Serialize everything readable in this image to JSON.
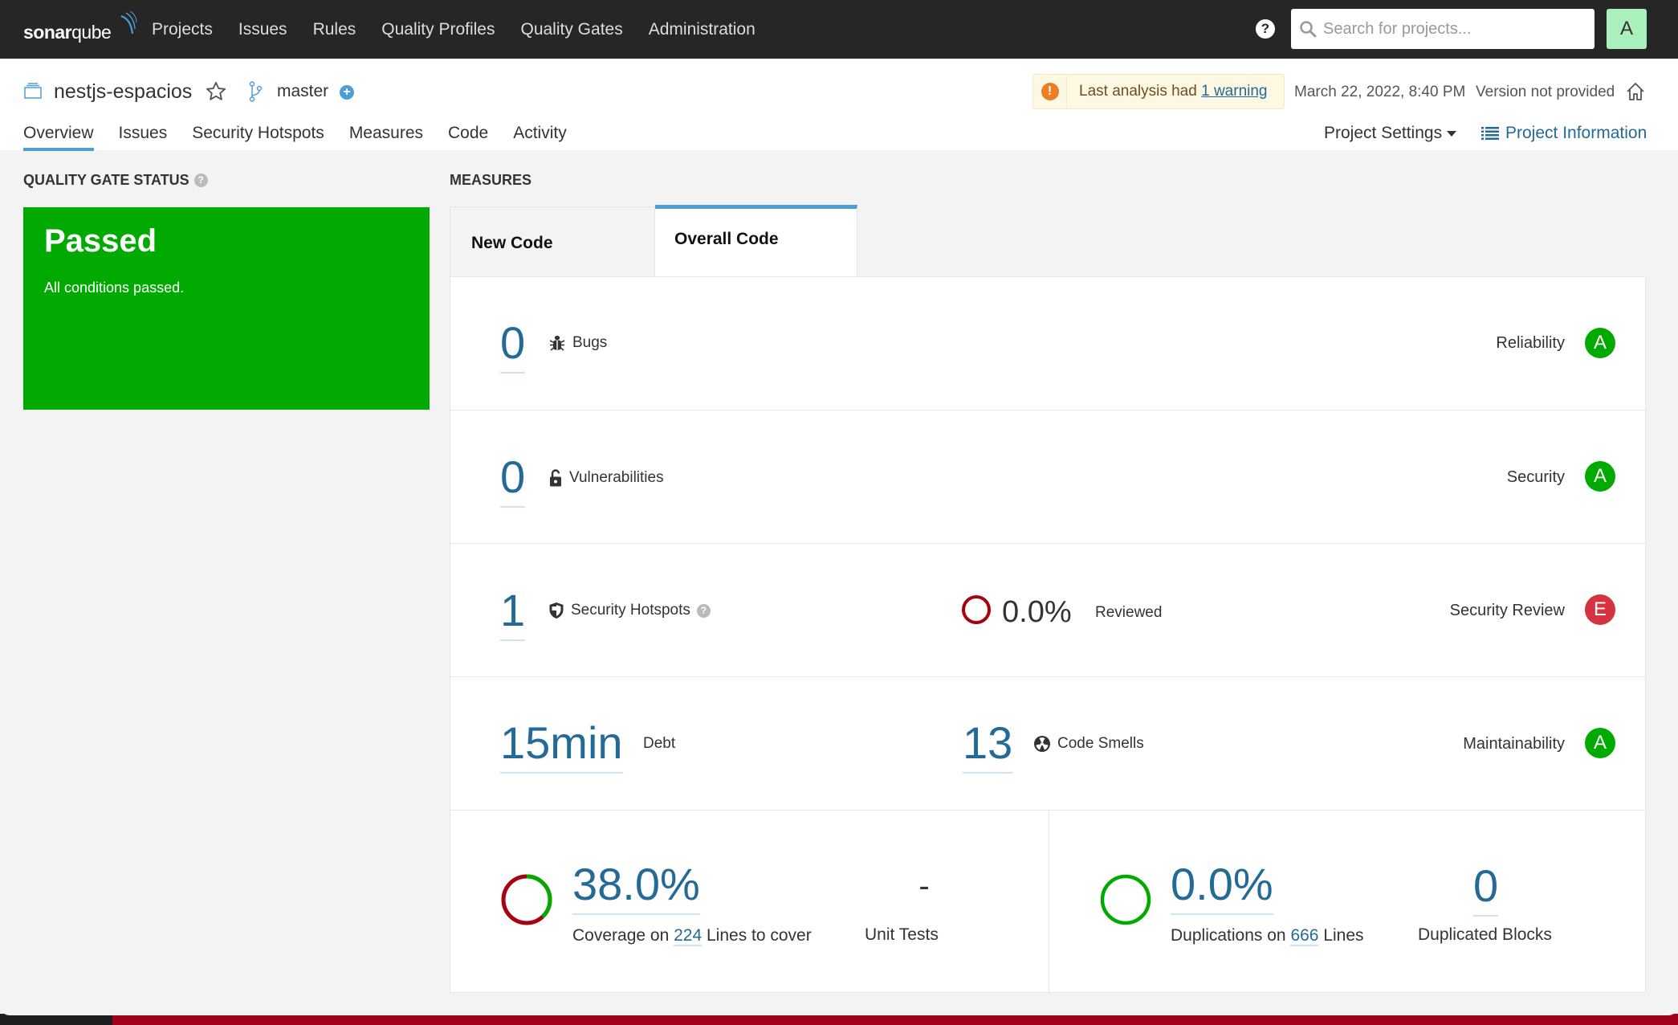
{
  "topnav": {
    "logo_bold": "sonar",
    "logo_thin": "qube",
    "items": [
      "Projects",
      "Issues",
      "Rules",
      "Quality Profiles",
      "Quality Gates",
      "Administration"
    ],
    "search_placeholder": "Search for projects...",
    "avatar_letter": "A"
  },
  "project": {
    "name": "nestjs-espacios",
    "branch": "master",
    "warning_prefix": "Last analysis had",
    "warning_link": "1 warning",
    "analysis_date": "March 22, 2022, 8:40 PM",
    "version": "Version not provided",
    "tabs": [
      "Overview",
      "Issues",
      "Security Hotspots",
      "Measures",
      "Code",
      "Activity"
    ],
    "active_tab": "Overview",
    "settings_label": "Project Settings",
    "info_label": "Project Information"
  },
  "quality_gate": {
    "title": "QUALITY GATE STATUS",
    "status": "Passed",
    "message": "All conditions passed.",
    "color": "#00aa00"
  },
  "measures": {
    "title": "MEASURES",
    "tabs": [
      "New Code",
      "Overall Code"
    ],
    "active_tab": "Overall Code",
    "bugs": {
      "value": "0",
      "label": "Bugs",
      "rating_label": "Reliability",
      "rating": "A"
    },
    "vulnerabilities": {
      "value": "0",
      "label": "Vulnerabilities",
      "rating_label": "Security",
      "rating": "A"
    },
    "hotspots": {
      "value": "1",
      "label": "Security Hotspots",
      "reviewed_value": "0.0%",
      "reviewed_label": "Reviewed",
      "rating_label": "Security Review",
      "rating": "E"
    },
    "maintainability": {
      "debt_value": "15min",
      "debt_label": "Debt",
      "smells_value": "13",
      "smells_label": "Code Smells",
      "rating_label": "Maintainability",
      "rating": "A"
    },
    "coverage": {
      "value": "38.0%",
      "percent": 38.0,
      "label_prefix": "Coverage on",
      "lines": "224",
      "label_suffix": "Lines to cover",
      "unit_tests_value": "-",
      "unit_tests_label": "Unit Tests"
    },
    "duplications": {
      "value": "0.0%",
      "percent": 0.0,
      "label_prefix": "Duplications on",
      "lines": "666",
      "label_suffix": "Lines",
      "blocks_value": "0",
      "blocks_label": "Duplicated Blocks"
    }
  },
  "colors": {
    "rating_A": "#00aa00",
    "rating_E": "#d4333f",
    "link": "#236a97",
    "accent": "#4b9fd5",
    "danger": "#a4030f"
  }
}
